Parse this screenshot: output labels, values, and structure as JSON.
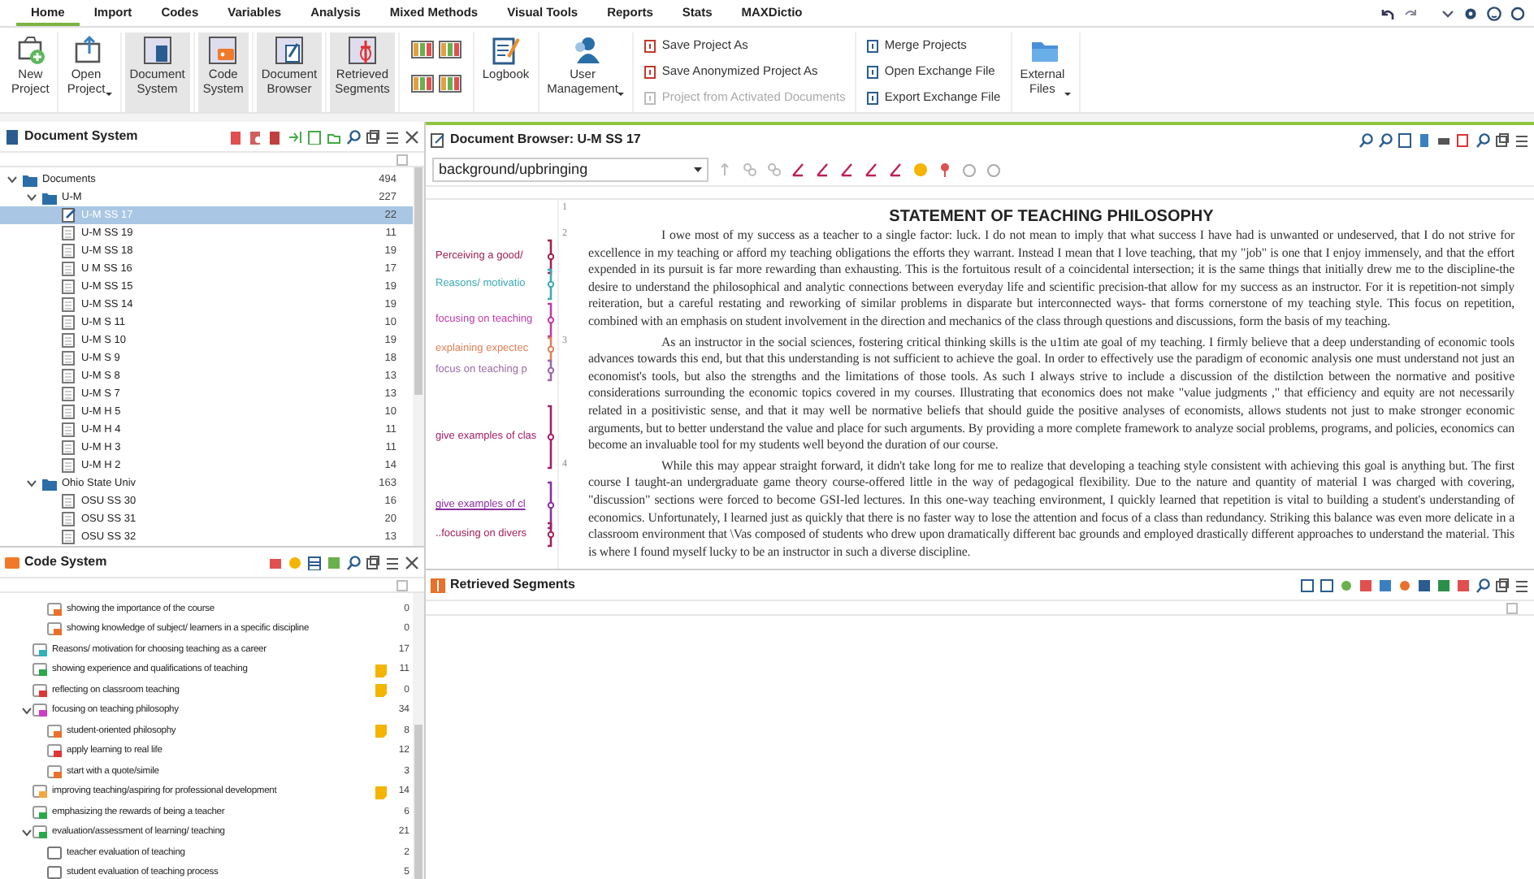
{
  "ribbon_tabs": [
    {
      "label": "Home",
      "selected": true
    },
    {
      "label": "Import",
      "selected": false
    },
    {
      "label": "Codes",
      "selected": false
    },
    {
      "label": "Variables",
      "selected": false
    },
    {
      "label": "Analysis",
      "selected": false
    },
    {
      "label": "Mixed Methods",
      "selected": false
    },
    {
      "label": "Visual Tools",
      "selected": false
    },
    {
      "label": "Reports",
      "selected": false
    },
    {
      "label": "Stats",
      "selected": false
    },
    {
      "label": "MAXDictio",
      "selected": false
    }
  ],
  "ribbon": [
    {
      "kind": "big",
      "label": "New\nProject",
      "menu": false,
      "selected": false
    },
    {
      "kind": "big",
      "label": "Open\nProject",
      "menu": true,
      "selected": false
    },
    {
      "kind": "big",
      "label": "Document\nSystem",
      "menu": false,
      "selected": true
    },
    {
      "kind": "big",
      "label": "Code\nSystem",
      "menu": false,
      "selected": true
    },
    {
      "kind": "big",
      "label": "Document\nBrowser",
      "menu": false,
      "selected": true
    },
    {
      "kind": "big",
      "label": "Retrieved\nSegments",
      "menu": false,
      "selected": true
    },
    {
      "kind": "layouts"
    },
    {
      "kind": "big",
      "label": "Logbook",
      "menu": false,
      "selected": false
    },
    {
      "kind": "big",
      "label": "User\nManagement",
      "menu": true,
      "selected": false
    },
    {
      "kind": "small",
      "items": [
        {
          "label": "Save Project As",
          "disabled": false
        },
        {
          "label": "Save Anonymized Project As",
          "disabled": false
        },
        {
          "label": "Project from Activated Documents",
          "disabled": true
        }
      ]
    },
    {
      "kind": "small",
      "items": [
        {
          "label": "Merge Projects",
          "disabled": false
        },
        {
          "label": "Open Exchange File",
          "disabled": false
        },
        {
          "label": "Export Exchange File",
          "disabled": false
        }
      ]
    },
    {
      "kind": "big",
      "label": "External\nFiles",
      "menu": true,
      "selected": false
    }
  ],
  "document_system": {
    "title": "Document System",
    "tree": [
      {
        "label": "Documents",
        "count": "494",
        "kind": "folder",
        "expanded": true,
        "selected": false,
        "children": [
          {
            "label": "U-M",
            "count": "227",
            "kind": "folder",
            "expanded": true,
            "selected": false,
            "children": [
              {
                "label": "U-M SS 17",
                "count": "22",
                "kind": "open-doc",
                "selected": true
              },
              {
                "label": "U-M SS 19",
                "count": "11",
                "kind": "doc",
                "selected": false
              },
              {
                "label": "U-M SS 18",
                "count": "19",
                "kind": "doc",
                "selected": false
              },
              {
                "label": "U M SS 16",
                "count": "17",
                "kind": "doc",
                "selected": false
              },
              {
                "label": "U-M SS 15",
                "count": "19",
                "kind": "doc",
                "selected": false
              },
              {
                "label": "U-M SS 14",
                "count": "19",
                "kind": "doc",
                "selected": false
              },
              {
                "label": "U-M S 11",
                "count": "10",
                "kind": "doc",
                "selected": false
              },
              {
                "label": "U-M S 10",
                "count": "19",
                "kind": "doc",
                "selected": false
              },
              {
                "label": "U-M S 9",
                "count": "18",
                "kind": "doc",
                "selected": false
              },
              {
                "label": "U-M S 8",
                "count": "13",
                "kind": "doc",
                "selected": false
              },
              {
                "label": "U-M S 7",
                "count": "13",
                "kind": "doc",
                "selected": false
              },
              {
                "label": "U-M H 5",
                "count": "10",
                "kind": "doc",
                "selected": false
              },
              {
                "label": "U-M H 4",
                "count": "11",
                "kind": "doc",
                "selected": false
              },
              {
                "label": "U-M H 3",
                "count": "11",
                "kind": "doc",
                "selected": false
              },
              {
                "label": "U-M H 2",
                "count": "14",
                "kind": "doc",
                "selected": false
              }
            ]
          },
          {
            "label": "Ohio State Univ",
            "count": "163",
            "kind": "folder",
            "expanded": true,
            "selected": false,
            "children": [
              {
                "label": "OSU SS 30",
                "count": "16",
                "kind": "doc",
                "selected": false
              },
              {
                "label": "OSU SS 31",
                "count": "20",
                "kind": "doc",
                "selected": false
              },
              {
                "label": "OSU SS 32",
                "count": "13",
                "kind": "doc",
                "selected": false
              }
            ]
          }
        ]
      }
    ]
  },
  "code_system": {
    "title": "Code System",
    "scrolled_children": [
      {
        "label": "showing the importance of the course",
        "count": "0",
        "color": "#e8702a",
        "memo": false
      },
      {
        "label": "showing knowledge of subject/ learners in a specific discipline",
        "count": "0",
        "color": "#e8702a",
        "memo": false
      }
    ],
    "codes": [
      {
        "label": "Reasons/ motivation for choosing teaching as a career",
        "count": "17",
        "color": "#2fb3b8",
        "memo": false
      },
      {
        "label": "showing experience and qualifications of teaching",
        "count": "11",
        "color": "#2aa84a",
        "memo": true
      },
      {
        "label": "reflecting on classroom teaching",
        "count": "0",
        "color": "#e03535",
        "memo": true
      },
      {
        "label": "focusing on teaching philosophy",
        "count": "34",
        "color": "#d23cc4",
        "memo": false,
        "expanded": true,
        "children": [
          {
            "label": "student-oriented philosophy",
            "count": "8",
            "color": "#e8702a",
            "memo": true
          },
          {
            "label": "apply learning to real life",
            "count": "12",
            "color": "#e03535",
            "memo": false
          },
          {
            "label": "start with a quote/simile",
            "count": "3",
            "color": "#e8702a",
            "memo": false
          }
        ]
      },
      {
        "label": "improving teaching/aspiring for professional development",
        "count": "14",
        "color": "#f4a640",
        "memo": true
      },
      {
        "label": "emphasizing the rewards of being a teacher",
        "count": "6",
        "color": "#2aa84a",
        "memo": false
      },
      {
        "label": "evaluation/assessment of learning/ teaching",
        "count": "21",
        "color": "#2aa84a",
        "memo": false,
        "expanded": true,
        "children": [
          {
            "label": "teacher evaluation of teaching",
            "count": "2",
            "memo": false
          },
          {
            "label": "student evaluation of teaching process",
            "count": "5",
            "memo": false
          }
        ]
      }
    ]
  },
  "document_browser": {
    "title": "Document Browser: U-M SS 17",
    "code_dropdown": "background/upbringing",
    "coded_segments": [
      {
        "label": "Perceiving a good/",
        "color": "#a3204f"
      },
      {
        "label": "Reasons/ motivatio",
        "color": "#3aaab5"
      },
      {
        "label": "focusing on teaching",
        "color": "#c23aa8"
      },
      {
        "label": "explaining expectec",
        "color": "#e0805a"
      },
      {
        "label": "focus on teaching p",
        "color": "#9a6aa8"
      },
      {
        "label": "give examples of clas",
        "color": "#a3206a"
      },
      {
        "label": "give examples of cl",
        "color": "#8a2ea0"
      },
      {
        "label": "..focusing on divers",
        "color": "#a3205a"
      }
    ],
    "paragraphs": [
      {
        "number": "1",
        "kind": "title",
        "text": "STATEMENT OF TEACHING PHILOSOPHY"
      },
      {
        "number": "2",
        "kind": "body",
        "text": "I owe most of my success as a teacher to a single factor: luck. I do not mean to imply that what success I have had is unwanted or undeserved, that I do not strive for excellence in my teaching or afford my teaching obligations the efforts they warrant. Instead I mean that I love teaching, that my \"job\" is one that I enjoy immensely, and that the effort expended in its pursuit is far more rewarding than exhausting. This is the fortuitous result of a coincidental intersection; it is the same things that initially drew me to the discipline-the desire to understand the philosophical and analytic connections between everyday life and scientific precision-that allow for my success as an instructor. For it is repetition-not simply reiteration, but a careful restating and reworking of similar problems in disparate but interconnected ways- that forms cornerstone of my teaching style. This focus on repetition, combined with an emphasis on student involvement in the direction and mechanics of the class through questions and discussions, form the basis of my teaching."
      },
      {
        "number": "3",
        "kind": "body",
        "text": "As an instructor in the social sciences, fostering critical thinking skills is the u1tim ate goal of my teaching. I firmly believe that a deep understanding of economic tools advances towards this end, but that this understanding is not sufficient to achieve the goal. In order to effectively use the paradigm of economic analysis one must understand not just an economist's tools, but also the strengths and the limitations of those tools. As such I always strive to include a discussion of the distilction between the normative and positive considerations surrounding the economic topics covered in my courses. Illustrating that economics does not make \"value judgments ,\" that efficiency and equity are not necessarily related in a positivistic sense, and that it may well be normative beliefs that should guide the positive analyses of economists, allows students not just to make stronger economic arguments, but to better understand the value and place for such arguments. By providing a more complete framework to analyze social problems, programs, and policies, economics can become an invaluable tool for my students well beyond the duration of our course."
      },
      {
        "number": "4",
        "kind": "body",
        "text": "While this may appear straight forward, it didn't take long for me to realize that developing a teaching style consistent with achieving this goal is anything but. The first course I taught-an undergraduate game theory course-offered little in the way of pedagogical flexibility. Due to the nature and quantity of material I was charged with covering, \"discussion\" sections were forced to become GSI-led lectures. In this one-way teaching environment, I quickly learned that repetition is vital to building a student's understanding of economics. Unfortunately, I learned just as quickly that there is no faster way to lose the attention and focus of a class than redundancy. Striking this balance was even more delicate in a classroom environment that \\Vas composed of students who drew upon dramatically different bac grounds and employed drastically different approaches to understand the material. This is where I found myself lucky to be an instructor in such a diverse discipline."
      }
    ]
  },
  "retrieved_segments": {
    "title": "Retrieved Segments"
  }
}
